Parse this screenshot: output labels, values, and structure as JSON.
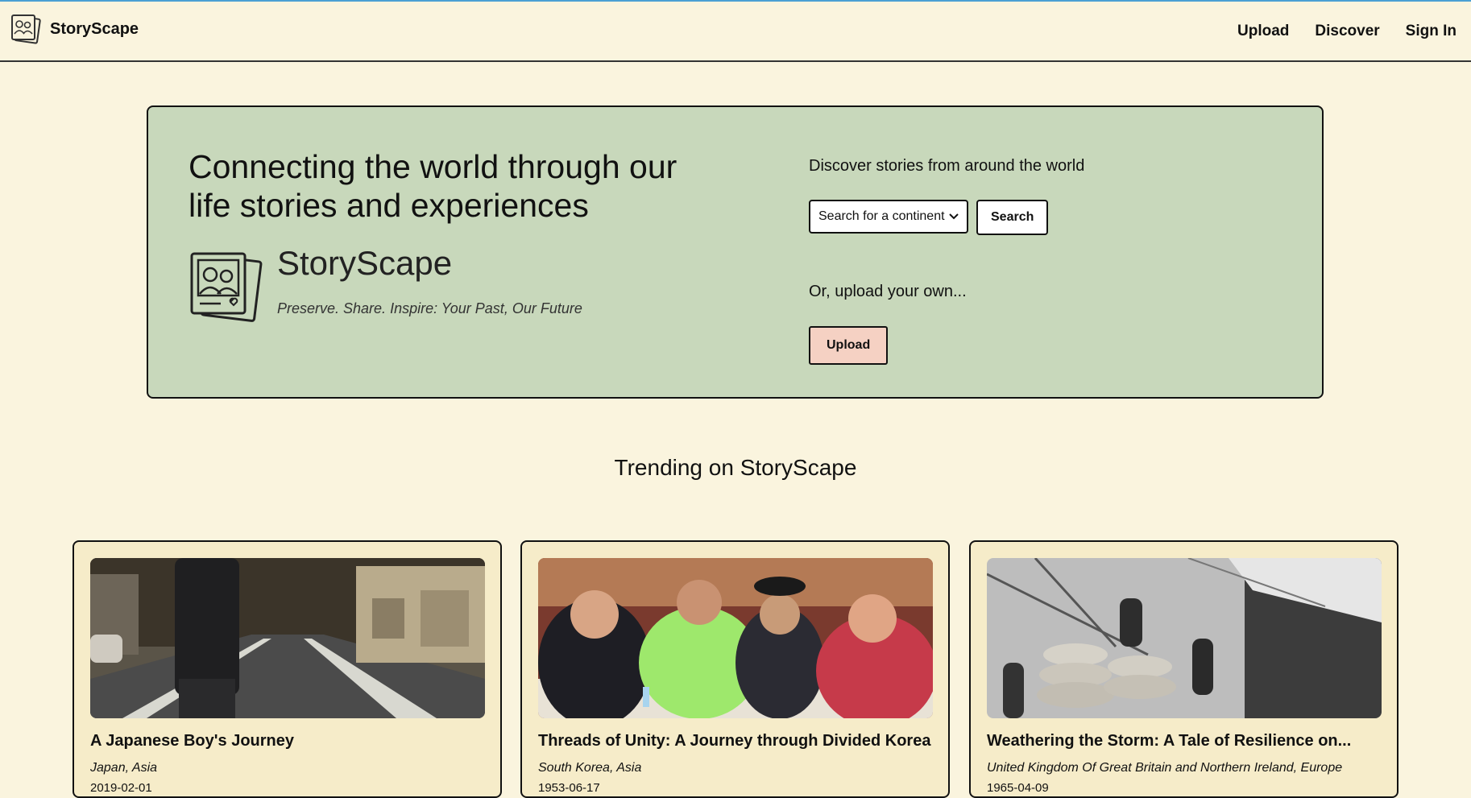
{
  "header": {
    "brand": "StoryScape",
    "nav": [
      "Upload",
      "Discover",
      "Sign In"
    ]
  },
  "hero": {
    "title": "Connecting the world through our life stories and experiences",
    "logo_name": "StoryScape",
    "tagline": "Preserve. Share. Inspire: Your Past, Our Future",
    "discover_label": "Discover stories from around the world",
    "select_value": "Search for a continent",
    "search_button": "Search",
    "upload_label": "Or, upload your own...",
    "upload_button": "Upload"
  },
  "trending": {
    "title": "Trending on StoryScape",
    "cards": [
      {
        "title": "A Japanese Boy's Journey",
        "location": "Japan, Asia",
        "date": "2019-02-01"
      },
      {
        "title": "Threads of Unity: A Journey through Divided Korea",
        "location": "South Korea, Asia",
        "date": "1953-06-17"
      },
      {
        "title": "Weathering the Storm: A Tale of Resilience on...",
        "location": "United Kingdom Of Great Britain and Northern Ireland, Europe",
        "date": "1965-04-09"
      }
    ]
  },
  "colors": {
    "page_bg": "#faf4de",
    "hero_bg": "#c8d8bb",
    "upload_button_bg": "#f5d1c3",
    "card_bg": "#f6ecc9"
  }
}
